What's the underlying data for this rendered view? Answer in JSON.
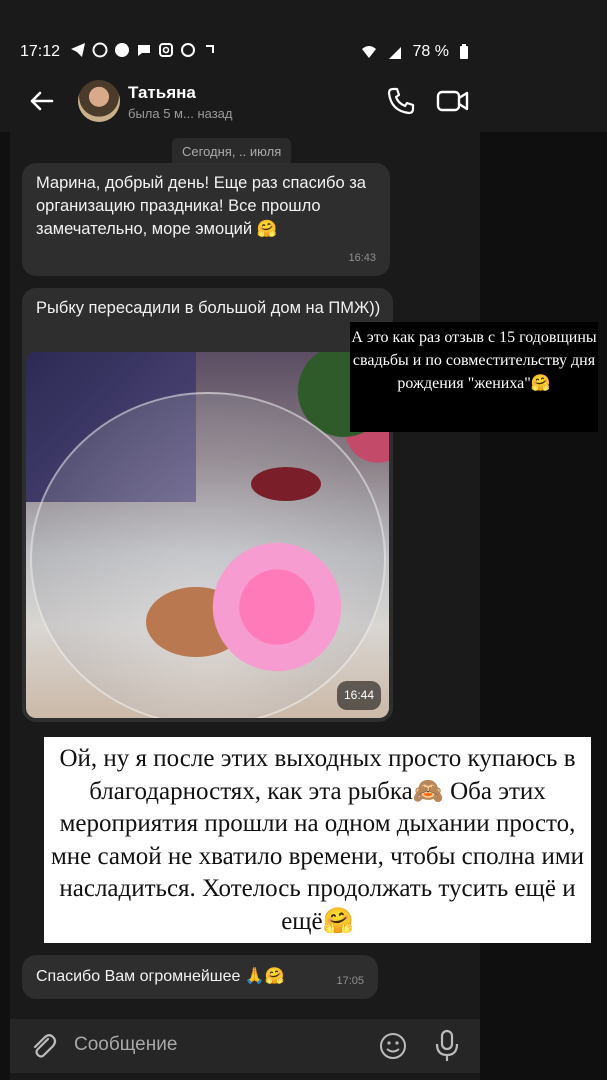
{
  "status_bar": {
    "time": "17:12",
    "battery": "78 %",
    "left_icons": [
      "telegram-icon",
      "whatsapp-icon",
      "chat-icon",
      "message-icon",
      "instagram-icon",
      "app-icon",
      "arrow-icon"
    ],
    "right_icons": [
      "wifi-icon",
      "signal-icon",
      "battery-icon"
    ]
  },
  "header": {
    "contact_name": "Татьяна",
    "last_seen": "была 5 м... назад"
  },
  "chat": {
    "date_chip": "Сегодня, .. июля",
    "message1": {
      "text": "Марина, добрый день! Еще раз спасибо за организацию праздника! Все прошло замечательно, море эмоций 🤗",
      "time": "16:43"
    },
    "message2": {
      "text": "Рыбку пересадили в большой дом на ПМЖ))",
      "photo_time": "16:44"
    },
    "message3": {
      "text": "Спасибо Вам огромнейшее 🙏🤗",
      "time": "17:05"
    }
  },
  "overlays": {
    "note_small": "А это как раз отзыв с 15 годовщины свадьбы и по совместительству дня рождения \"жениха\"🤗",
    "note_big": "Ой, ну я после этих выходных просто купаюсь в благодарностях, как эта рыбка🙈 Оба этих мероприятия прошли на одном дыхании просто, мне самой не хватило времени, чтобы сполна ими насладиться. Хотелось продолжать тусить ещё и ещё🤗"
  },
  "composer": {
    "placeholder": "Сообщение"
  },
  "colors": {
    "background": "#1a1a1a",
    "bubble": "#2e2e2e",
    "note_small_bg": "#000000",
    "note_big_bg": "#ffffff"
  }
}
